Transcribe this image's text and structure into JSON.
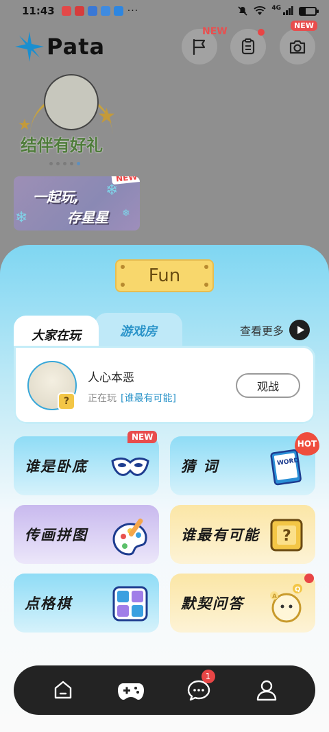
{
  "status_bar": {
    "time": "11:43",
    "network": "4G",
    "dots": "···"
  },
  "header": {
    "logo_text": "Pata",
    "flag_badge": "NEW",
    "camera_badge": "NEW"
  },
  "banner_main": {
    "title": "结伴有好礼"
  },
  "banner_small": {
    "line1": "一起玩,",
    "line2": "存星星",
    "badge": "NEW"
  },
  "section": {
    "title": "Fun"
  },
  "tabs": [
    {
      "label": "大家在玩"
    },
    {
      "label": "游戏房"
    }
  ],
  "see_more": "查看更多",
  "player": {
    "name": "人心本恶",
    "status_prefix": "正在玩",
    "game": "[谁最有可能]",
    "watch_button": "观战"
  },
  "games": [
    {
      "label": "谁是卧底",
      "badge": "NEW"
    },
    {
      "label": "猜 词",
      "badge": "HOT"
    },
    {
      "label": "传画拼图"
    },
    {
      "label": "谁最有可能"
    },
    {
      "label": "点格棋"
    },
    {
      "label": "默契问答"
    }
  ],
  "nav": {
    "messages_badge": "1"
  },
  "colors": {
    "accent_blue": "#2b94c9",
    "badge_red": "#e84d4d",
    "nav_bg": "#232323"
  }
}
